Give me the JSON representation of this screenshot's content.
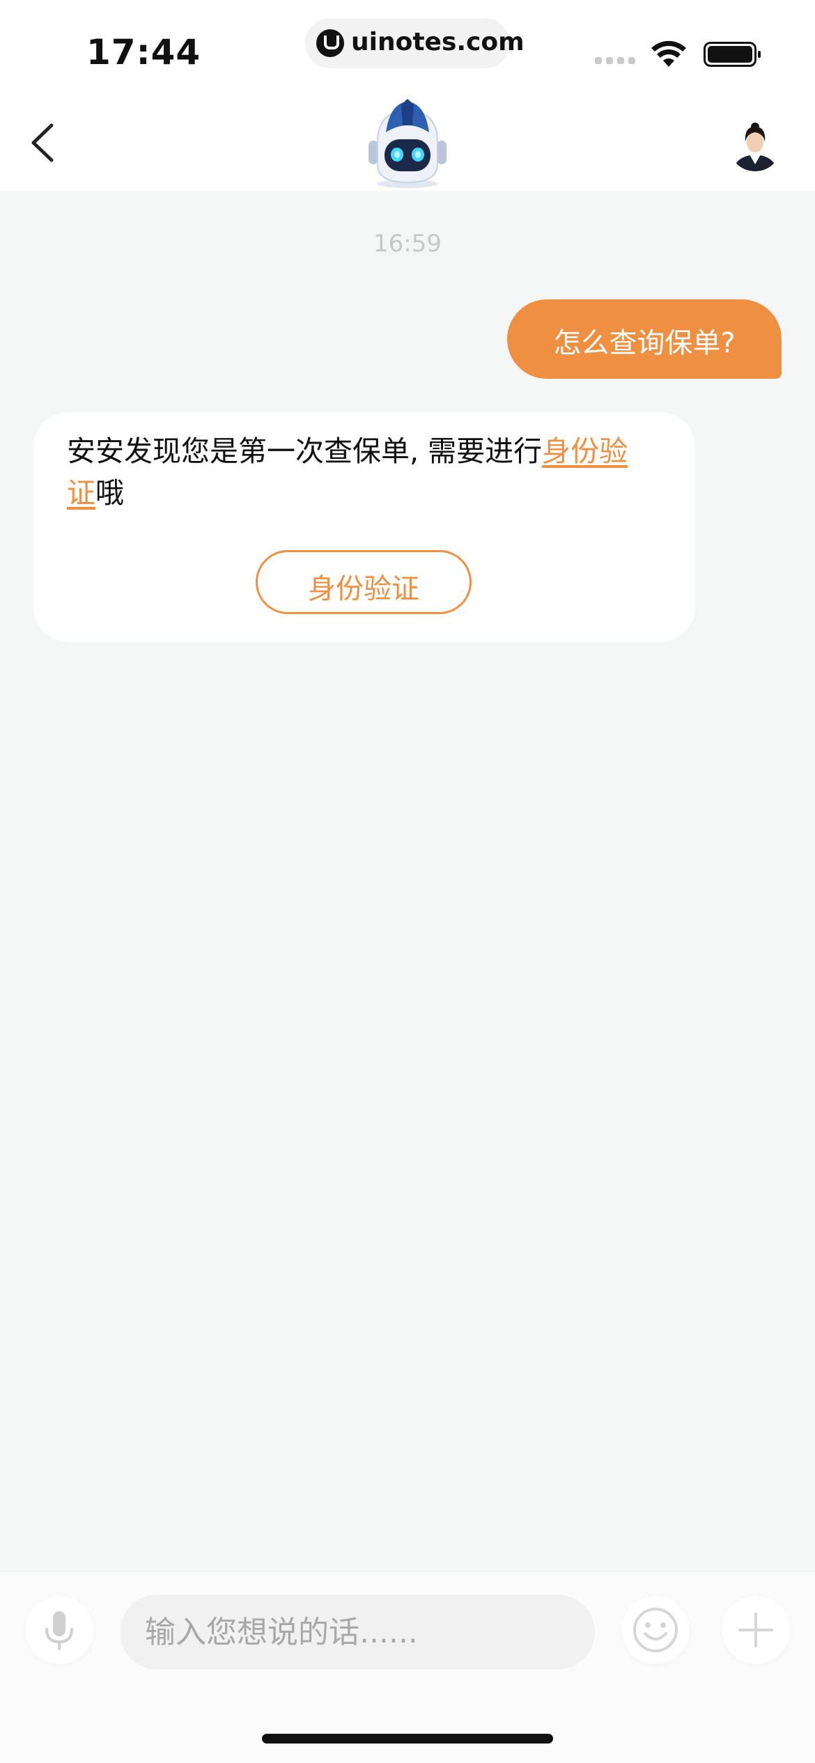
{
  "status_bar": {
    "time": "17:44",
    "url": "uinotes.com"
  },
  "nav": {
    "back_icon": "chevron-left-icon",
    "bot_avatar": "robot-mascot-icon",
    "agent_avatar": "human-agent-avatar"
  },
  "chat": {
    "timestamp": "16:59",
    "user_message": "怎么查询保单?",
    "bot_text_before": "安安发现您是第一次查保单, 需要进行",
    "bot_link": "身份验证",
    "bot_text_after": "哦",
    "verify_button": "身份验证"
  },
  "composer": {
    "mic_icon": "microphone-icon",
    "placeholder": "输入您想说的话......",
    "emoji_icon": "smiley-icon",
    "plus_icon": "plus-icon"
  },
  "colors": {
    "accent": "#ef8f42",
    "background": "#f4f5f5",
    "card": "#ffffff"
  }
}
